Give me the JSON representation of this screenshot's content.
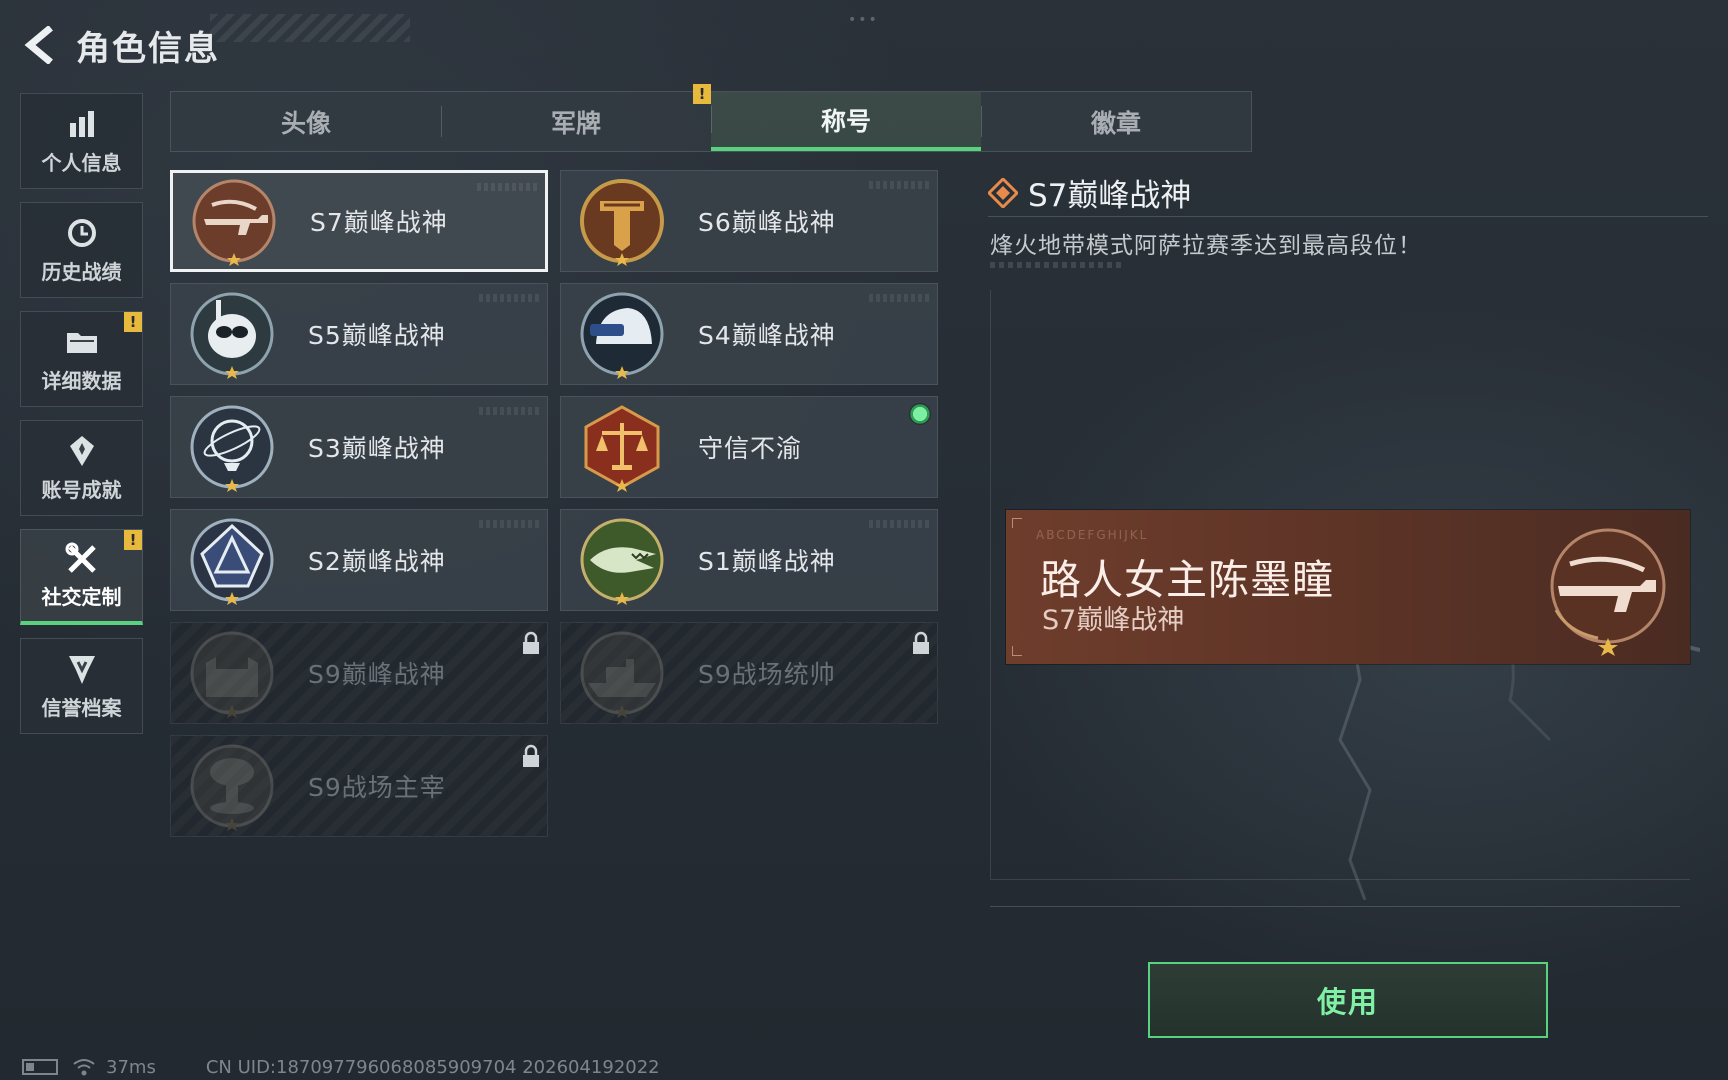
{
  "header": {
    "title": "角色信息"
  },
  "sidebar": {
    "items": [
      {
        "label": "个人信息",
        "icon": "bar-chart-icon",
        "alert": false,
        "active": false
      },
      {
        "label": "历史战绩",
        "icon": "history-icon",
        "alert": false,
        "active": false
      },
      {
        "label": "详细数据",
        "icon": "folder-icon",
        "alert": true,
        "active": false
      },
      {
        "label": "账号成就",
        "icon": "medal-icon",
        "alert": false,
        "active": false
      },
      {
        "label": "社交定制",
        "icon": "tools-icon",
        "alert": true,
        "active": true
      },
      {
        "label": "信誉档案",
        "icon": "shield-badge-icon",
        "alert": false,
        "active": false
      }
    ]
  },
  "tabs": [
    {
      "label": "头像",
      "active": false
    },
    {
      "label": "军牌",
      "active": false,
      "alert": true
    },
    {
      "label": "称号",
      "active": true
    },
    {
      "label": "徽章",
      "active": false
    }
  ],
  "alert_mark": "!",
  "titles": [
    {
      "name": "S7巅峰战神",
      "emblem": "rifle-emblem-icon",
      "selected": true,
      "locked": false
    },
    {
      "name": "S6巅峰战神",
      "emblem": "t-shield-emblem-icon",
      "selected": false,
      "locked": false
    },
    {
      "name": "S5巅峰战神",
      "emblem": "diver-skull-emblem-icon",
      "selected": false,
      "locked": false
    },
    {
      "name": "S4巅峰战神",
      "emblem": "helmet-emblem-icon",
      "selected": false,
      "locked": false
    },
    {
      "name": "S3巅峰战神",
      "emblem": "globe-emblem-icon",
      "selected": false,
      "locked": false
    },
    {
      "name": "守信不渝",
      "emblem": "scales-emblem-icon",
      "selected": false,
      "locked": false,
      "equipped": true
    },
    {
      "name": "S2巅峰战神",
      "emblem": "triangle-emblem-icon",
      "selected": false,
      "locked": false
    },
    {
      "name": "S1巅峰战神",
      "emblem": "crocodile-emblem-icon",
      "selected": false,
      "locked": false
    },
    {
      "name": "S9巅峰战神",
      "emblem": "fortress-emblem-icon",
      "selected": false,
      "locked": true
    },
    {
      "name": "S9战场统帅",
      "emblem": "warship-emblem-icon",
      "selected": false,
      "locked": true
    },
    {
      "name": "S9战场主宰",
      "emblem": "mushroom-cloud-emblem-icon",
      "selected": false,
      "locked": true
    }
  ],
  "detail": {
    "name": "S7巅峰战神",
    "description": "烽火地带模式阿萨拉赛季达到最高段位！"
  },
  "nameplate": {
    "code": "ABCDEFGHIJKL",
    "player_name": "路人女主陈墨瞳",
    "title": "S7巅峰战神"
  },
  "use_button": {
    "label": "使用"
  },
  "status": {
    "ping": "37ms",
    "uid": "CN UID:18709779606808590970​4 202604192022"
  },
  "colors": {
    "accent_green": "#58d27e",
    "alert_yellow": "#e7b93c",
    "nameplate_bronze": "#6f3d2c"
  }
}
